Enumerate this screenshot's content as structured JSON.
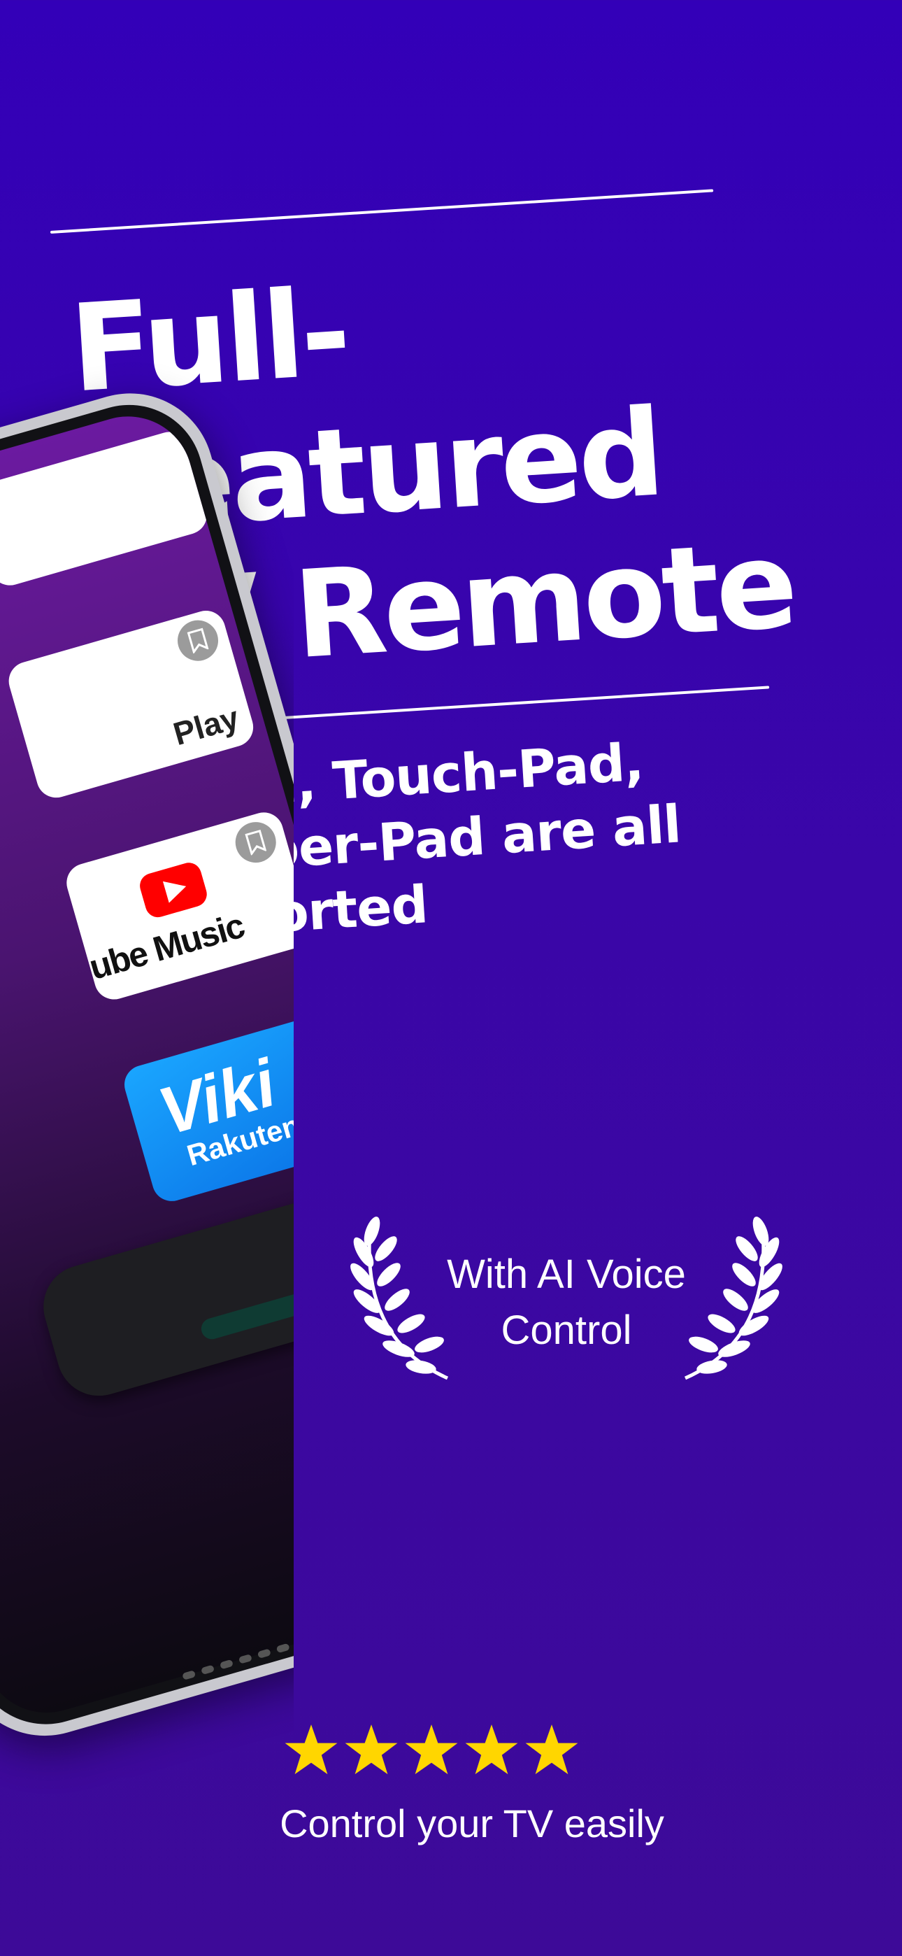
{
  "headline": {
    "line1": "Full-Featured",
    "line2": "TV Remote"
  },
  "subheadline": {
    "line1": "D-Pad, Touch-Pad,",
    "line2": "Number-Pad are all",
    "line3": "supported"
  },
  "award": {
    "line1": "With AI Voice",
    "line2": "Control"
  },
  "rating": {
    "stars": 5,
    "star_color": "#ffd600",
    "caption": "Control your TV easily"
  },
  "phone": {
    "tiles": [
      {
        "name": "google-play",
        "label": "Play"
      },
      {
        "name": "youtube-music",
        "label": "ube Music"
      },
      {
        "name": "viki-rakuten",
        "label": "Viki",
        "sublabel": "Rakuten"
      }
    ],
    "icons": [
      "bookmark-icon",
      "gear-icon"
    ]
  },
  "colors": {
    "background_top": "#3300b8",
    "background_bottom": "#3d0a98",
    "text": "#ffffff"
  }
}
